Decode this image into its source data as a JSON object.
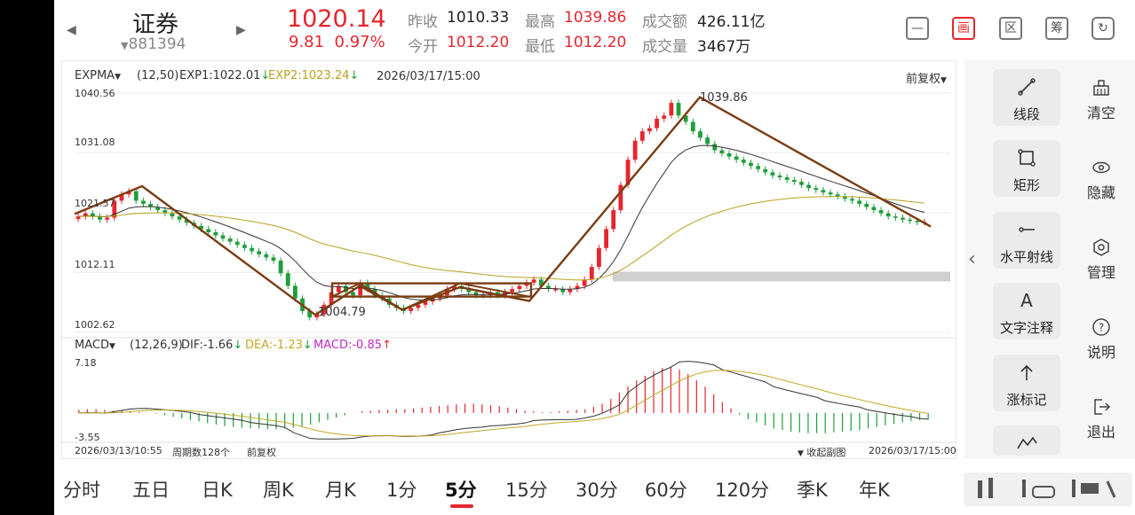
{
  "header": {
    "stock_name": "证券",
    "stock_code": "881394",
    "price": "1020.14",
    "change": "9.81",
    "change_pct": "0.97%",
    "prev_close_label": "昨收",
    "prev_close": "1010.33",
    "open_label": "今开",
    "open": "1012.20",
    "high_label": "最高",
    "high": "1039.86",
    "low_label": "最低",
    "low": "1012.20",
    "amount_label": "成交额",
    "amount": "426.11亿",
    "volume_label": "成交量",
    "volume": "3467万",
    "icons": [
      "minimize-icon",
      "chart-mode-icon",
      "zone-icon",
      "chip-icon",
      "rotate-screen-icon"
    ],
    "chart_mode_glyph": "画",
    "zone_glyph": "区",
    "chip_glyph": "筹"
  },
  "main_chart": {
    "indicator": "EXPMA",
    "params": "(12,50)",
    "exp1": "EXP1:1022.01",
    "exp2": "EXP2:1023.24",
    "datetime": "2026/03/17/15:00",
    "adjust": "前复权",
    "y_labels": [
      "1040.56",
      "1031.08",
      "1021.57",
      "1012.11",
      "1002.62"
    ],
    "high_annotation": "1039.86",
    "low_annotation": "1004.79"
  },
  "sub_chart": {
    "indicator": "MACD",
    "params": "(12,26,9)",
    "dif": "DIF:-1.66",
    "dea": "DEA:-1.23",
    "macd": "MACD:-0.85",
    "y_top": "7.18",
    "y_bottom": "-3.55"
  },
  "footer": {
    "start_time": "2026/03/13/10:55",
    "period_count": "周期数128个",
    "adjust": "前复权",
    "collapse": "收起副图",
    "end_time": "2026/03/17/15:00"
  },
  "tools": [
    {
      "label": "线段",
      "icon": "line-segment-icon"
    },
    {
      "label": "矩形",
      "icon": "rectangle-icon"
    },
    {
      "label": "水平射线",
      "icon": "horizontal-ray-icon"
    },
    {
      "label": "文字注释",
      "icon": "text-annotation-icon",
      "glyph": "A"
    },
    {
      "label": "涨标记",
      "icon": "up-mark-icon"
    }
  ],
  "right_actions": [
    {
      "label": "清空",
      "icon": "clear-icon"
    },
    {
      "label": "隐藏",
      "icon": "hide-eye-icon"
    },
    {
      "label": "管理",
      "icon": "manage-icon"
    },
    {
      "label": "说明",
      "icon": "help-icon"
    },
    {
      "label": "退出",
      "icon": "exit-icon"
    }
  ],
  "period_tabs": [
    "分时",
    "五日",
    "日K",
    "周K",
    "月K",
    "1分",
    "5分",
    "15分",
    "30分",
    "60分",
    "120分",
    "季K",
    "年K"
  ],
  "active_tab": "5分",
  "colors": {
    "up": "#e5262d",
    "down": "#1f9e3a",
    "exp1": "#333333",
    "exp2": "#b8a11f",
    "draw": "#7a3c13",
    "dea": "#c5a623",
    "macd": "#c02ac0"
  },
  "chart_data": [
    {
      "type": "candlestick",
      "title": "EXPMA",
      "y_axis_ticks": [
        1040.56,
        1031.08,
        1021.57,
        1012.11,
        1002.62
      ],
      "ylim": [
        1002.62,
        1040.56
      ],
      "x_range": [
        "2026/03/13/10:55",
        "2026/03/17/15:00"
      ],
      "period_count": 128,
      "marked_high": 1039.86,
      "marked_low": 1004.79,
      "last_close": 1020.14,
      "series": [
        {
          "name": "EXP1",
          "last": 1022.01
        },
        {
          "name": "EXP2",
          "last": 1023.24
        }
      ],
      "close_series_approx": [
        1021,
        1021.5,
        1021,
        1020.5,
        1020.8,
        1023.5,
        1024.5,
        1025,
        1023.5,
        1023,
        1022.5,
        1022,
        1021.5,
        1021,
        1020.5,
        1020,
        1019.5,
        1019,
        1018.5,
        1018,
        1017.5,
        1017,
        1016.5,
        1016,
        1015.5,
        1015,
        1014.5,
        1014,
        1012,
        1010,
        1008,
        1006,
        1005,
        1005.5,
        1007,
        1009,
        1010,
        1009,
        1008.5,
        1010.5,
        1009.5,
        1008.5,
        1008,
        1007,
        1006.5,
        1006,
        1006.5,
        1007,
        1007.5,
        1008,
        1008.5,
        1009.5,
        1010,
        1009.5,
        1009,
        1008.5,
        1008.5,
        1009,
        1008.5,
        1009,
        1009.5,
        1010,
        1010.5,
        1011,
        1010,
        1009.5,
        1009.5,
        1009,
        1009.5,
        1010,
        1011,
        1013,
        1016,
        1019,
        1022,
        1026,
        1030,
        1033,
        1034.5,
        1035,
        1036.5,
        1037,
        1039,
        1037,
        1036,
        1034.5,
        1033.5,
        1032.5,
        1031.5,
        1031,
        1030.5,
        1030,
        1029.5,
        1029,
        1028.5,
        1028,
        1027.5,
        1027.2,
        1026.8,
        1026.5,
        1026,
        1025.5,
        1025.2,
        1024.8,
        1024.5,
        1024.2,
        1023.8,
        1023.5,
        1023,
        1022.5,
        1022,
        1021.5,
        1021,
        1020.8,
        1020.5,
        1020.3,
        1020.1,
        1020.14
      ]
    },
    {
      "type": "bar",
      "title": "MACD",
      "ylim": [
        -3.55,
        7.18
      ],
      "series": [
        {
          "name": "DIF",
          "last": -1.66
        },
        {
          "name": "DEA",
          "last": -1.23
        },
        {
          "name": "MACD",
          "last": -0.85
        }
      ],
      "macd_hist_approx": [
        0.4,
        0.5,
        0.5,
        0.4,
        0.3,
        0.3,
        0.2,
        0.1,
        0,
        -0.1,
        -0.3,
        -0.5,
        -0.7,
        -0.9,
        -1.1,
        -1.3,
        -1.5,
        -1.7,
        -1.8,
        -1.9,
        -2.0,
        -2.0,
        -2.1,
        -2.1,
        -2.0,
        -1.9,
        -1.7,
        -1.5,
        -1.2,
        -0.9,
        -0.6,
        -0.3,
        0,
        0.2,
        0.3,
        0.4,
        0.4,
        0.5,
        0.5,
        0.6,
        0.7,
        0.8,
        0.9,
        1.0,
        1.1,
        1.2,
        1.2,
        1.1,
        1.0,
        0.9,
        0.7,
        0.5,
        0.3,
        0.2,
        0.1,
        0.1,
        0.2,
        0.3,
        0.4,
        0.5,
        0.8,
        1.2,
        1.8,
        2.6,
        3.4,
        4.2,
        4.8,
        5.4,
        5.8,
        6.0,
        5.6,
        5.0,
        4.2,
        3.4,
        2.4,
        1.4,
        0.6,
        -0.2,
        -0.8,
        -1.2,
        -1.6,
        -2.0,
        -2.2,
        -2.4,
        -2.5,
        -2.6,
        -2.6,
        -2.6,
        -2.5,
        -2.4,
        -2.3,
        -2.2,
        -2.0,
        -1.8,
        -1.6,
        -1.4,
        -1.2,
        -1.0,
        -0.9,
        -0.85
      ]
    }
  ]
}
